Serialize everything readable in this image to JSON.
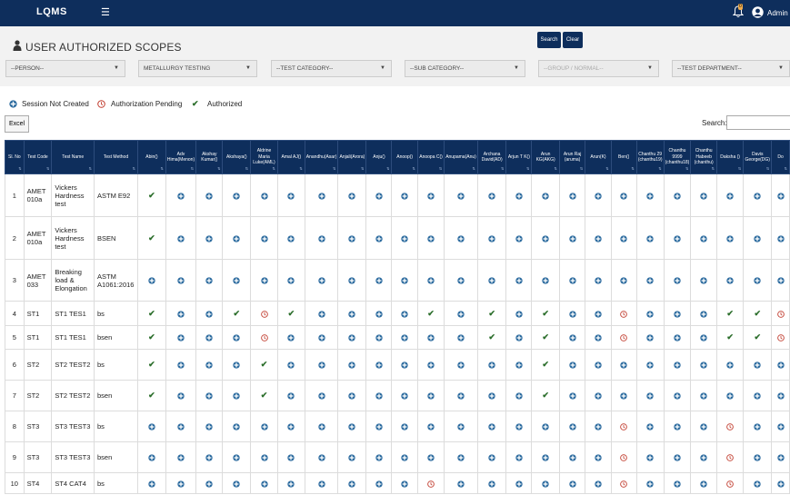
{
  "app": {
    "name": "LQMS",
    "user": "Admin",
    "notification_count": "0"
  },
  "page": {
    "title": "USER AUTHORIZED SCOPES"
  },
  "buttons": {
    "search": "Search",
    "clear": "Clear",
    "excel": "Excel"
  },
  "filters": {
    "person": "--PERSON--",
    "department": "METALLURGY TESTING",
    "test_category": "--TEST CATEGORY--",
    "sub_category": "--SUB CATEGORY--",
    "group": "--GROUP / NORMAL--",
    "test_department": "--TEST DEPARTMENT--"
  },
  "legend": {
    "session_not_created": "Session Not Created",
    "authorization_pending": "Authorization Pending",
    "authorized": "Authorized"
  },
  "table_search_label": "Search:",
  "colors": {
    "navy": "#0e2e5c",
    "session_blue": "#2b6a9e",
    "pending_red": "#c0392b",
    "authorized_green": "#2b6e2b"
  },
  "table": {
    "headers": [
      "Sl. No",
      "Test Code",
      "Test Name",
      "Test Method"
    ],
    "persons": [
      "Abin()",
      "Adv Hima(Menon)",
      "Akshay Kumar()",
      "Akshaya()",
      "Aldrine Maria Luke(AML)",
      "Amal AJ()",
      "Anandhu(Asar)",
      "Anjali(Arora)",
      "Anju()",
      "Anoop()",
      "Anoopa C()",
      "Anupama(Anu)",
      "Archana David(AD)",
      "Arjun T K()",
      "Arun KG(AKG)",
      "Arun Raj (aruma)",
      "Arun(K)",
      "Ben()",
      "Chanthu 29 (chanthu19)",
      "Chanthu 9999 (chanthu18)",
      "Chanthu Habeeb (chanthu)",
      "Daksha ()",
      "Davis George(DG)",
      "Do"
    ],
    "rows": [
      {
        "sl": "1",
        "code": "AMET 010a",
        "name": "Vickers Hardness test",
        "method": "ASTM E92",
        "status": "ASSSSSSSSSSSSSSSSSSSSSSS"
      },
      {
        "sl": "2",
        "code": "AMET 010a",
        "name": "Vickers Hardness test",
        "method": "BSEN",
        "status": "ASSSSSSSSSSSSSSSSSSSSSSS"
      },
      {
        "sl": "3",
        "code": "AMET 033",
        "name": "Breaking load & Elongation",
        "method": "ASTM A1061:2016",
        "status": "SSSSSSSSSSSSSSSSSSSSSSSS"
      },
      {
        "sl": "4",
        "code": "ST1",
        "name": "ST1 TES1",
        "method": "bs",
        "status": "ASSAPASSSSASASASSPSSSAAP"
      },
      {
        "sl": "5",
        "code": "ST1",
        "name": "ST1 TES1",
        "method": "bsen",
        "status": "ASSSPSSSSSSSASASSPSSSAAP"
      },
      {
        "sl": "6",
        "code": "ST2",
        "name": "ST2 TEST2",
        "method": "bs",
        "status": "ASSSASSSSSSSSSASSSSSSSSS"
      },
      {
        "sl": "7",
        "code": "ST2",
        "name": "ST2 TEST2",
        "method": "bsen",
        "status": "ASSSASSSSSSSSSASSSSSSSSS"
      },
      {
        "sl": "8",
        "code": "ST3",
        "name": "ST3 TEST3",
        "method": "bs",
        "status": "SSSSSSSSSSSSSSSSSPSSSPSS"
      },
      {
        "sl": "9",
        "code": "ST3",
        "name": "ST3 TEST3",
        "method": "bsen",
        "status": "SSSSSSSSSSSSSSSSSPSSSPSS"
      },
      {
        "sl": "10",
        "code": "ST4",
        "name": "ST4 CAT4",
        "method": "bs",
        "status": "SSSSSSSSSSPSSSSSSPSSSPSS"
      }
    ]
  }
}
